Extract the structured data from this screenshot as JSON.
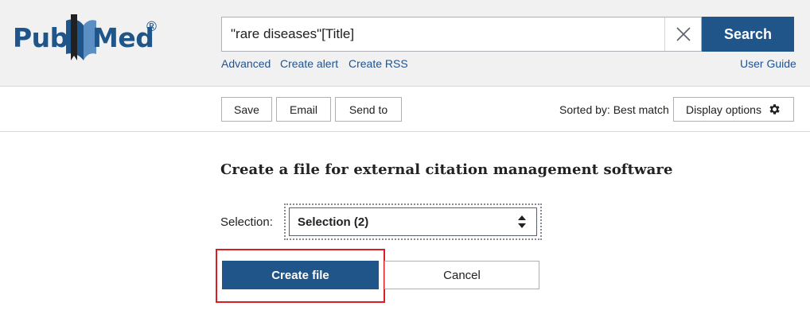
{
  "header": {
    "logo": {
      "part1": "Pub",
      "part2": "Med",
      "registered": "®"
    },
    "search": {
      "value": "\"rare diseases\"[Title]",
      "clear_icon": "close-icon",
      "button_label": "Search"
    },
    "links": {
      "advanced": "Advanced",
      "create_alert": "Create alert",
      "create_rss": "Create RSS",
      "user_guide": "User Guide"
    }
  },
  "toolbar": {
    "save_label": "Save",
    "email_label": "Email",
    "send_to_label": "Send to",
    "sorted_by": "Sorted by: Best match",
    "display_options_label": "Display options",
    "display_options_icon": "gear-icon"
  },
  "citation_panel": {
    "title": "Create a file for external citation management software",
    "selection_label": "Selection:",
    "selection_value": "Selection (2)",
    "selection_icon": "sort-arrows-icon",
    "create_label": "Create file",
    "cancel_label": "Cancel"
  },
  "colors": {
    "brand_blue": "#20558a",
    "link_blue": "#205493",
    "header_bg": "#f1f1f1",
    "highlight_red": "#d91e25"
  }
}
